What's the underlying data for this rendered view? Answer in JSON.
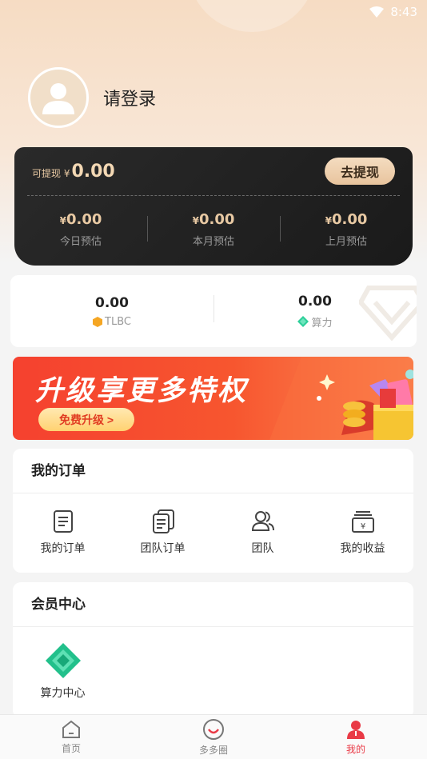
{
  "status_bar": {
    "time": "8:43"
  },
  "profile": {
    "login_text": "请登录"
  },
  "earnings": {
    "withdrawable_label": "可提现 ¥",
    "withdrawable_value": "0.00",
    "withdraw_button": "去提现",
    "stats": [
      {
        "currency": "¥",
        "value": "0.00",
        "label": "今日预估"
      },
      {
        "currency": "¥",
        "value": "0.00",
        "label": "本月预估"
      },
      {
        "currency": "¥",
        "value": "0.00",
        "label": "上月预估"
      }
    ]
  },
  "assets": [
    {
      "value": "0.00",
      "label": "TLBC",
      "icon": "tlbc-hexagon-icon"
    },
    {
      "value": "0.00",
      "label": "算力",
      "icon": "diamond-icon"
    }
  ],
  "banner": {
    "title": "升级享更多特权",
    "button": "免费升级 >"
  },
  "orders": {
    "title": "我的订单",
    "items": [
      {
        "label": "我的订单",
        "icon": "order-doc-icon"
      },
      {
        "label": "团队订单",
        "icon": "team-orders-icon"
      },
      {
        "label": "团队",
        "icon": "team-people-icon"
      },
      {
        "label": "我的收益",
        "icon": "earnings-box-icon"
      }
    ]
  },
  "member": {
    "title": "会员中心",
    "items": [
      {
        "label": "算力中心",
        "icon": "green-diamond-icon"
      }
    ]
  },
  "tabbar": {
    "items": [
      {
        "label": "首页",
        "icon": "home-icon"
      },
      {
        "label": "多多圈",
        "icon": "smile-circle-icon"
      },
      {
        "label": "我的",
        "icon": "person-icon",
        "active": true
      }
    ]
  },
  "colors": {
    "accent": "#e93a46",
    "gold": "#e8c9a3",
    "banner_red": "#f5412f"
  }
}
